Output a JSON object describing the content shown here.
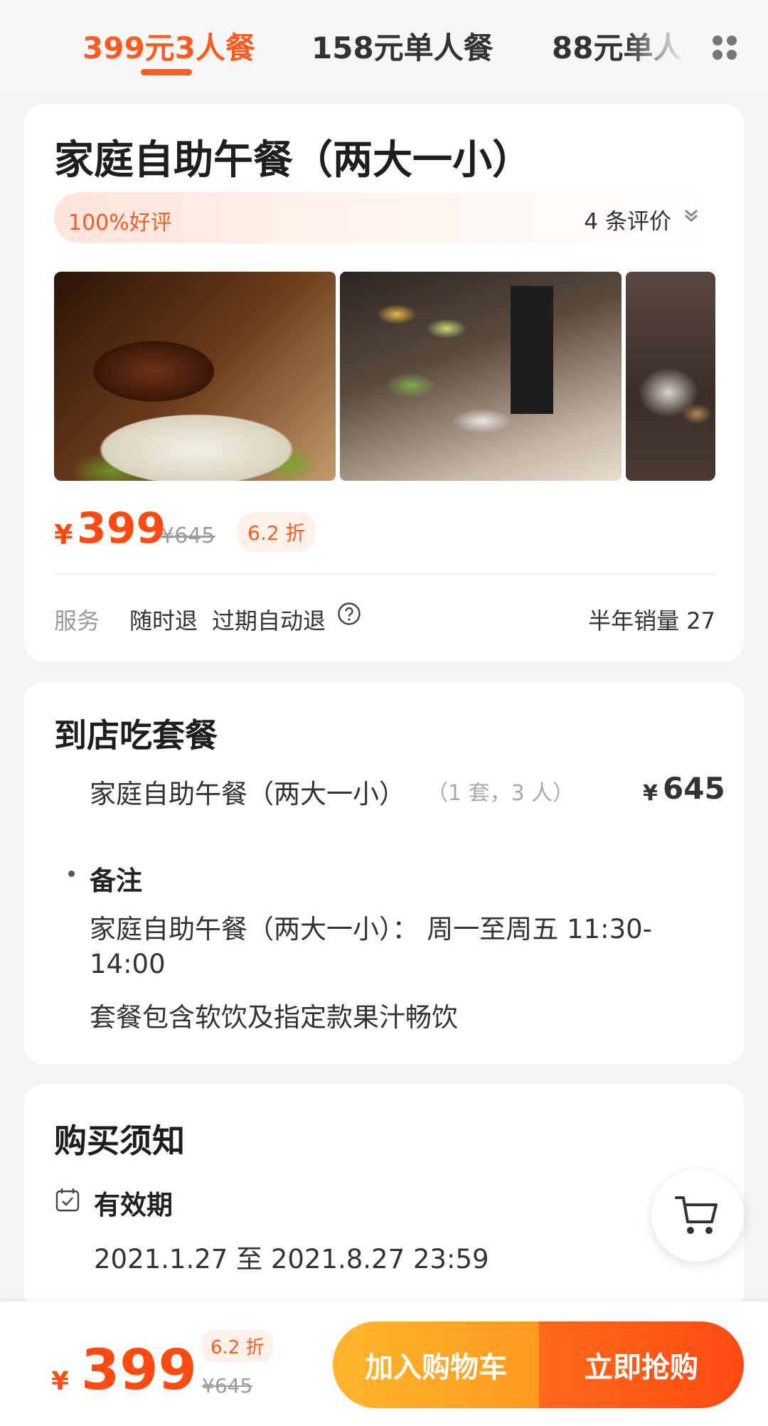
{
  "tabs": [
    {
      "label": "399元3人餐",
      "active": true
    },
    {
      "label": "158元单人餐",
      "active": false
    },
    {
      "label": "88元单人",
      "active": false
    }
  ],
  "deal": {
    "title": "家庭自助午餐（两大一小）",
    "rating": "100%好评",
    "review_count": "4 条评价",
    "price_symbol": "¥",
    "price": "399",
    "original_price": "¥645",
    "discount": "6.2 折",
    "service_label": "服务",
    "services": [
      "随时退",
      "过期自动退"
    ],
    "sales": "半年销量 27"
  },
  "package": {
    "section_title": "到店吃套餐",
    "item_name": "家庭自助午餐（两大一小）",
    "item_qty": "（1 套，3 人）",
    "item_price_symbol": "¥",
    "item_price": "645",
    "note_label": "备注",
    "notes": [
      "家庭自助午餐（两大一小）：  周一至周五 11:30-14:00",
      "套餐包含软饮及指定款果汁畅饮"
    ]
  },
  "purchase_notes": {
    "section_title": "购买须知",
    "validity_label": "有效期",
    "validity_range": "2021.1.27 至 2021.8.27 23:59"
  },
  "bottom_bar": {
    "price_symbol": "¥",
    "price": "399",
    "discount": "6.2 折",
    "original_price": "¥645",
    "add_to_cart": "加入购物车",
    "buy_now": "立即抢购"
  },
  "colors": {
    "accent": "#ff5a1f",
    "price": "#ff4a12",
    "cart_button": "#ffa726",
    "buy_button": "#ff5a1a"
  },
  "icons": [
    "grid-icon",
    "chevron-down-icon",
    "help-icon",
    "calendar-check-icon",
    "cart-icon"
  ]
}
